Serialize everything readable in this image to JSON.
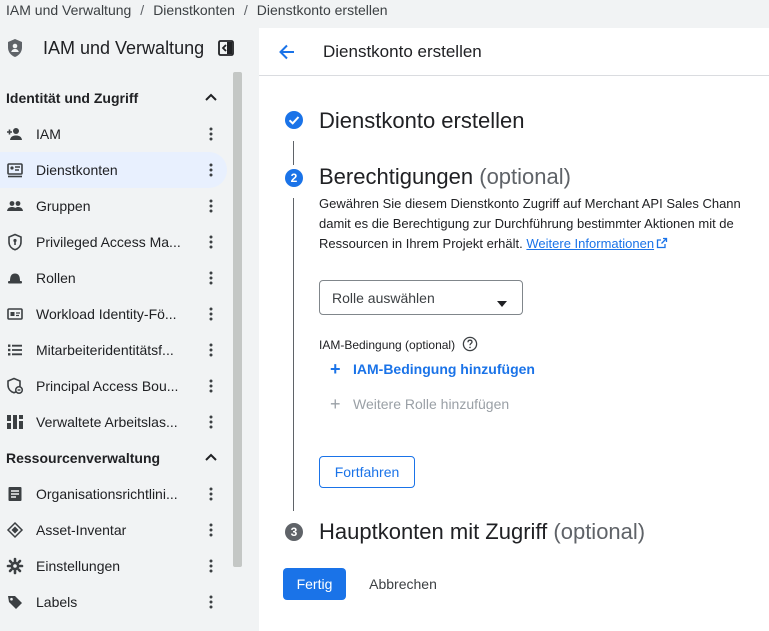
{
  "breadcrumb": [
    "IAM und Verwaltung",
    "Dienstkonten",
    "Dienstkonto erstellen"
  ],
  "breadcrumb_sep": "/",
  "sidebar": {
    "title": "IAM und Verwaltung",
    "sections": [
      {
        "label": "Identität und Zugriff",
        "items": [
          {
            "label": "IAM",
            "icon": "person-add-icon",
            "active": false
          },
          {
            "label": "Dienstkonten",
            "icon": "service-account-icon",
            "active": true
          },
          {
            "label": "Gruppen",
            "icon": "group-icon",
            "active": false
          },
          {
            "label": "Privileged Access Ma...",
            "icon": "privileged-shield-icon",
            "active": false
          },
          {
            "label": "Rollen",
            "icon": "roles-hat-icon",
            "active": false
          },
          {
            "label": "Workload Identity-Fö...",
            "icon": "id-card-icon",
            "active": false
          },
          {
            "label": "Mitarbeiteridentitätsf...",
            "icon": "list-icon",
            "active": false
          },
          {
            "label": "Principal Access Bou...",
            "icon": "principal-shield-icon",
            "active": false
          },
          {
            "label": "Verwaltete Arbeitslas...",
            "icon": "workload-grid-icon",
            "active": false
          }
        ]
      },
      {
        "label": "Ressourcenverwaltung",
        "items": [
          {
            "label": "Organisationsrichtlini...",
            "icon": "policy-doc-icon",
            "active": false
          },
          {
            "label": "Asset-Inventar",
            "icon": "asset-diamond-icon",
            "active": false
          },
          {
            "label": "Einstellungen",
            "icon": "gear-icon",
            "active": false
          },
          {
            "label": "Labels",
            "icon": "label-tag-icon",
            "active": false
          }
        ]
      }
    ]
  },
  "main": {
    "topbar_title": "Dienstkonto erstellen",
    "steps": [
      {
        "number": "1",
        "title": "Dienstkonto erstellen",
        "optional": "",
        "state": "done"
      },
      {
        "number": "2",
        "title": "Berechtigungen",
        "optional": "(optional)",
        "state": "active"
      },
      {
        "number": "3",
        "title": "Hauptkonten mit Zugriff",
        "optional": "(optional)",
        "state": "pending"
      }
    ],
    "description": {
      "line1": "Gewähren Sie diesem Dienstkonto Zugriff auf Merchant API Sales Chann",
      "line2": "damit es die Berechtigung zur Durchführung bestimmter Aktionen mit de",
      "line3": "Ressourcen in Ihrem Projekt erhält.",
      "link": "Weitere Informationen"
    },
    "role_select": {
      "value": "Rolle auswählen"
    },
    "condition_label": "IAM-Bedingung (optional)",
    "add_condition": "IAM-Bedingung hinzufügen",
    "add_role": "Weitere Rolle hinzufügen",
    "continue_button": "Fortfahren",
    "done_button": "Fertig",
    "cancel_button": "Abbrechen"
  },
  "colors": {
    "accent": "#1a73e8",
    "active_nav_bg": "#e8f0fe",
    "sidebar_bg": "#f1f3f4",
    "pending_step": "#5f6368"
  }
}
